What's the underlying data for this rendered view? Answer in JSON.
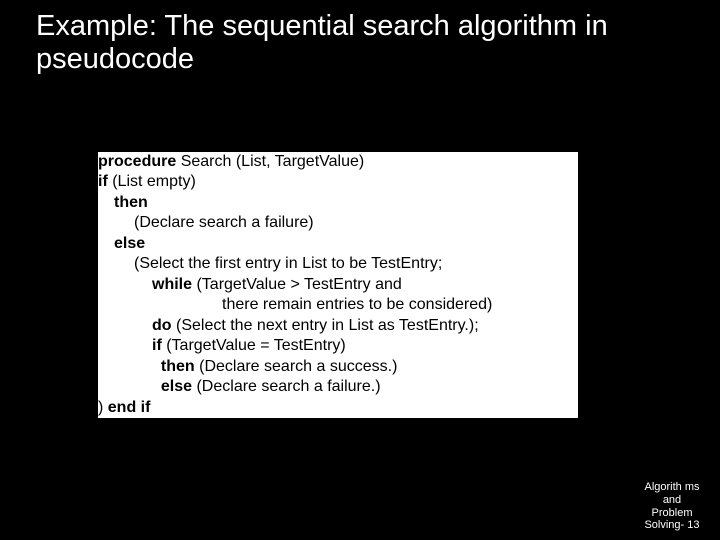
{
  "title": "Example: The sequential search algorithm in pseudocode",
  "code": {
    "l1a": "procedure",
    "l1b": " Search (List, TargetValue)",
    "l2a": "if",
    "l2b": " (List empty)",
    "l3a": "then",
    "l4": "(Declare search a failure)",
    "l5a": "else",
    "l6": "(Select the first entry in List to be TestEntry;",
    "l7a": "while",
    "l7b": " (TargetValue > TestEntry and",
    "l8": "there remain entries to be considered)",
    "l9a": "do",
    "l9b": " (Select the next entry in List as TestEntry.);",
    "l10a": "if",
    "l10b": " (TargetValue = TestEntry)",
    "l11a": "then",
    "l11b": " (Declare search a success.)",
    "l12a": "else",
    "l12b": " (Declare search a failure.)",
    "l13a": ") ",
    "l13b": "end if"
  },
  "footer": "Algorith\nms and\nProblem\nSolving-\n13"
}
